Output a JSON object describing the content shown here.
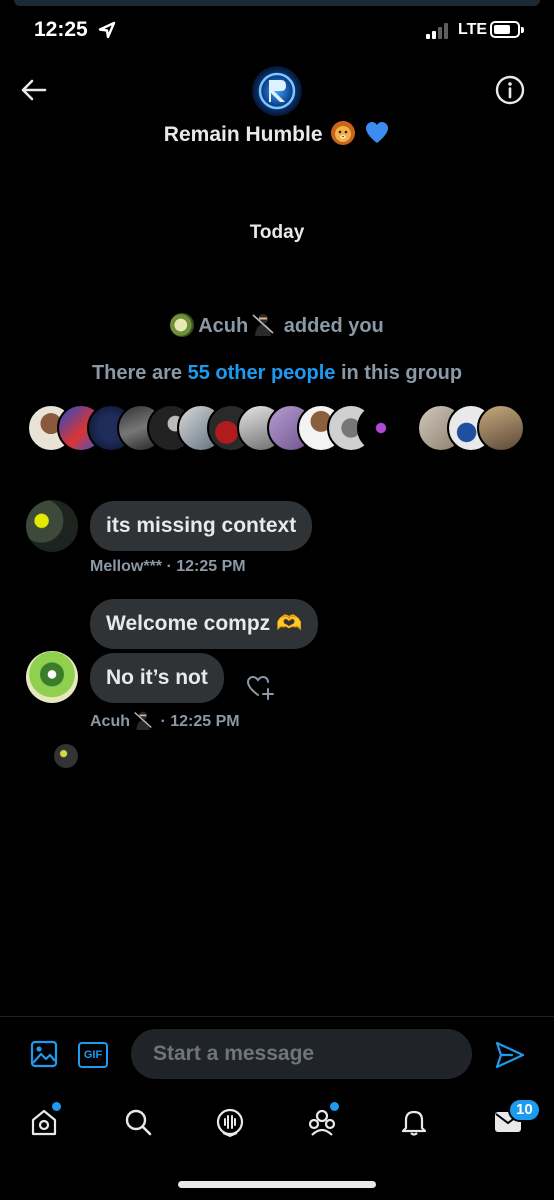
{
  "status_bar": {
    "time": "12:25",
    "network": "LTE"
  },
  "header": {
    "group_name": "Remain Humble",
    "group_emojis": "🦁💙"
  },
  "conversation": {
    "date_label": "Today",
    "system_added": {
      "actor": "Acuh",
      "text": "added you"
    },
    "system_members": {
      "prefix": "There are",
      "link": "55 other people",
      "suffix": "in this group"
    },
    "messages": [
      {
        "sender": "Mellow***",
        "time": "· 12:25 PM",
        "bubbles": [
          "its missing context"
        ]
      },
      {
        "sender": "Acuh",
        "time": "· 12:25 PM",
        "bubbles": [
          "Welcome compz 🫶",
          "No it’s not"
        ]
      }
    ]
  },
  "composer": {
    "gif_label": "GIF",
    "placeholder": "Start a message"
  },
  "tabbar": {
    "items": [
      "home",
      "search",
      "spaces",
      "communities",
      "notifications",
      "messages"
    ],
    "messages_badge": "10"
  },
  "colors": {
    "accent": "#1d9bf0",
    "bubble": "#2f3336",
    "muted": "#8b98a5",
    "background": "#000000"
  }
}
